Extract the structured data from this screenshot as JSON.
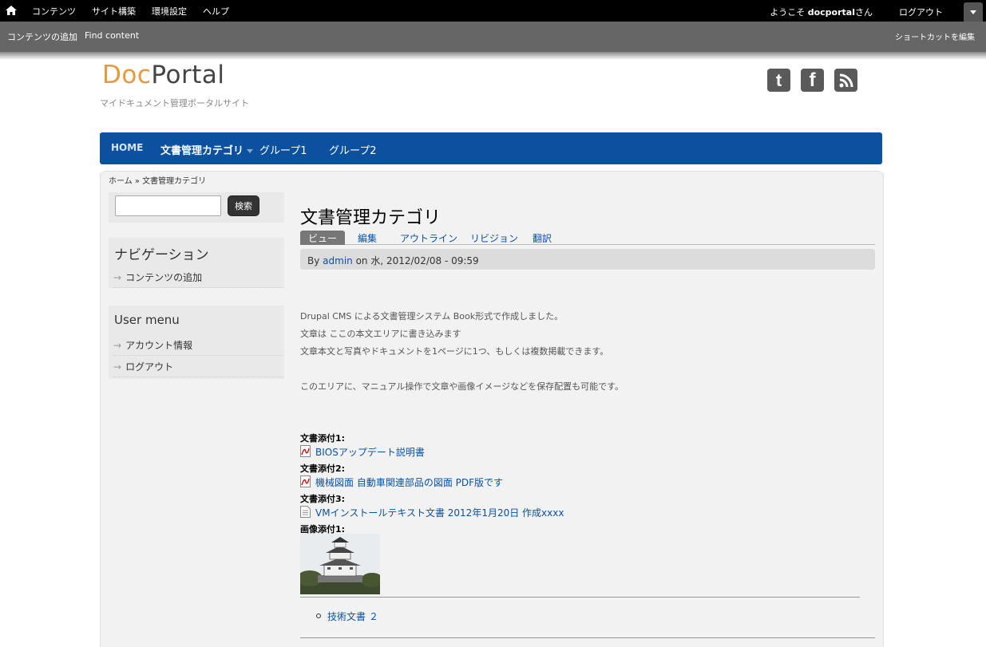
{
  "toolbar": {
    "menu": [
      "コンテンツ",
      "サイト構築",
      "環境設定",
      "ヘルプ"
    ],
    "welcome_prefix": "ようこそ ",
    "username": "docportal",
    "welcome_suffix": "さん",
    "logout": "ログアウト"
  },
  "shortcuts": {
    "add_content": "コンテンツの追加",
    "find_content": "Find content",
    "edit": "ショートカットを編集"
  },
  "site": {
    "logo_part1": "Doc",
    "logo_part2": "Portal",
    "slogan": "マイドキュメント管理ポータルサイト"
  },
  "social": {
    "twitter": "t",
    "facebook": "f"
  },
  "main_nav": {
    "home": "HOME",
    "category": "文書管理カテゴリ",
    "group1": "グループ1",
    "group2": "グループ2"
  },
  "breadcrumb": "ホーム » 文書管理カテゴリ",
  "sidebar": {
    "search_button": "検索",
    "navigation_title": "ナビゲーション",
    "navigation_items": [
      "コンテンツの追加"
    ],
    "user_menu_title": "User menu",
    "user_menu_items": [
      "アカウント情報",
      "ログアウト"
    ],
    "arrow": "→"
  },
  "node": {
    "title": "文書管理カテゴリ",
    "tabs": [
      "ビュー",
      "編集",
      "アウトライン",
      "リビジョン",
      "翻訳"
    ],
    "submitted_by": "By ",
    "author": "admin",
    "submitted_on": " on 水, 2012/02/08 - 09:59",
    "body": [
      "Drupal  CMS  による文書管理システム  Book形式で作成しました。",
      "文章は  ここの本文エリアに書き込みます",
      "文章本文と写真やドキュメントを1ページに1つ、もしくは複数掲載できます。",
      "このエリアに、マニュアル操作で文章や画像イメージなどを保存配置も可能です。"
    ],
    "attachments": [
      {
        "label": "文書添付1:",
        "file": "BIOSアップデート説明書",
        "icon": "pdf-icon"
      },
      {
        "label": "文書添付2:",
        "file": "機械図面  自動車関連部品の図面  PDF版です",
        "icon": "pdf-icon"
      },
      {
        "label": "文書添付3:",
        "file": "VMインストールテキスト文書  2012年1月20日  作成xxxx",
        "icon": "text-file-icon"
      }
    ],
    "image_label": "画像添付1:",
    "child_pages": [
      "技術文書 ２"
    ]
  }
}
